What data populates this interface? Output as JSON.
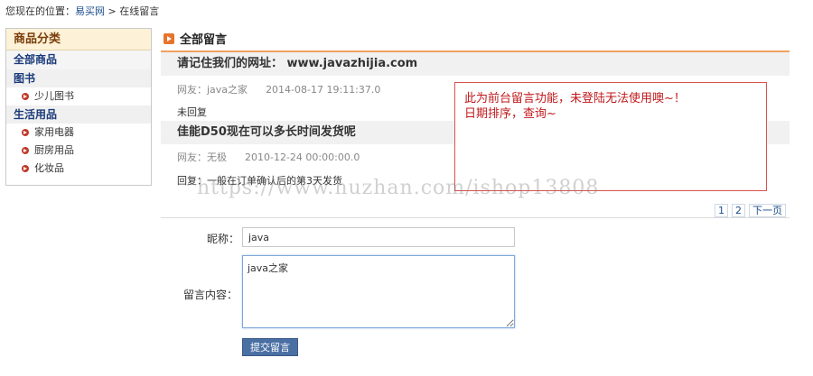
{
  "breadcrumb": {
    "prefix": "您现在的位置：",
    "home": "易买网",
    "separator": " > ",
    "current": "在线留言"
  },
  "sidebar": {
    "title": "商品分类",
    "all": "全部商品",
    "groups": [
      {
        "label": "图书",
        "items": [
          "少儿图书"
        ]
      },
      {
        "label": "生活用品",
        "items": [
          "家用电器",
          "厨房用品",
          "化妆品"
        ]
      }
    ]
  },
  "main": {
    "title": "全部留言",
    "messages": [
      {
        "title": "请记住我们的网址： www.javazhijia.com",
        "author": "网友：java之家",
        "time": "2014-08-17 19:11:37.0",
        "reply": "未回复"
      },
      {
        "title": "佳能D50现在可以多长时间发货呢",
        "author": "网友：无极",
        "time": "2010-12-24 00:00:00.0",
        "reply": "回复：一般在订单确认后的第3天发货"
      }
    ],
    "pager": [
      "1",
      "2",
      "下一页"
    ]
  },
  "note": {
    "line1": "此为前台留言功能，未登陆无法使用噢~！",
    "line2": "日期排序，查询~"
  },
  "watermark": "https://www.huzhan.com/ishop13808",
  "form": {
    "nickname_label": "昵称：",
    "nickname_value": "java",
    "content_label": "留言内容：",
    "content_value": "java之家",
    "submit_label": "提交留言"
  },
  "colors": {
    "accent": "#e8732a",
    "note_border": "#d9534f",
    "note_text": "#c0181b",
    "button": "#4a6fa3"
  }
}
